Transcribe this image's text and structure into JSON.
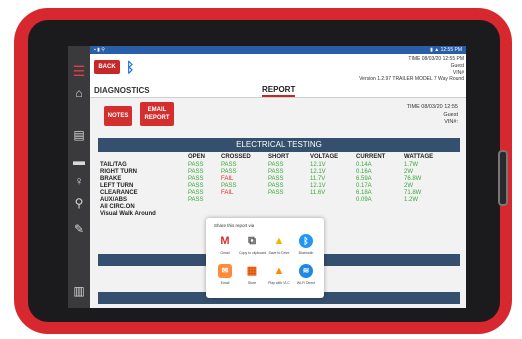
{
  "status_bar": {
    "left": "▪ ▮ ⚲",
    "right": "▮ ▲ 12:55 PM"
  },
  "header": {
    "back_label": "BACK",
    "time_line": "TIME 08/03/20 12:55 PM",
    "user_line": "Guest",
    "vin_line": "VIN#",
    "version_line": "Version 1.2.97   TRAILER MODEL 7 Way Round"
  },
  "tabs": {
    "diagnostics": "DIAGNOSTICS",
    "report": "REPORT"
  },
  "buttons": {
    "notes": "NOTES",
    "email_line1": "EMAIL",
    "email_line2": "REPORT"
  },
  "meta": {
    "time": "TIME 08/03/20 12:55",
    "user": "Guest",
    "vin": "VIN#:"
  },
  "electrical": {
    "title": "ELECTRICAL TESTING",
    "columns": [
      "OPEN",
      "CROSSED",
      "SHORT",
      "VOLTAGE",
      "CURRENT",
      "WATTAGE"
    ],
    "rows": [
      {
        "label": "TAIL/TAG",
        "open": "PASS",
        "crossed": "PASS",
        "short": "PASS",
        "voltage": "12.1V",
        "current": "0.14A",
        "wattage": "1.7W"
      },
      {
        "label": "RIGHT TURN",
        "open": "PASS",
        "crossed": "PASS",
        "short": "PASS",
        "voltage": "12.1V",
        "current": "0.16A",
        "wattage": "2W"
      },
      {
        "label": "BRAKE",
        "open": "PASS",
        "crossed": "FAIL",
        "short": "PASS",
        "voltage": "11.7V",
        "current": "6.59A",
        "wattage": "76.8W"
      },
      {
        "label": "LEFT TURN",
        "open": "PASS",
        "crossed": "PASS",
        "short": "PASS",
        "voltage": "12.1V",
        "current": "0.17A",
        "wattage": "2W"
      },
      {
        "label": "CLEARANCE",
        "open": "PASS",
        "crossed": "FAIL",
        "short": "PASS",
        "voltage": "11.6V",
        "current": "6.18A",
        "wattage": "71.8W"
      },
      {
        "label": "AUX/ABS",
        "open": "PASS",
        "crossed": "",
        "short": "",
        "voltage": "",
        "current": "0.09A",
        "wattage": "1.2W"
      },
      {
        "label": "All CIRC.ON",
        "open": "",
        "crossed": "",
        "short": "",
        "voltage": "",
        "current": "",
        "wattage": ""
      },
      {
        "label": "Visual Walk Around",
        "open": "",
        "crossed": "",
        "short": "",
        "voltage": "",
        "current": "",
        "wattage": ""
      }
    ]
  },
  "share": {
    "title": "Share this report via",
    "apps": [
      {
        "label": "Gmail",
        "icon": "gmail-icon",
        "glyph": "M"
      },
      {
        "label": "Copy to clipboard",
        "icon": "copy-icon",
        "glyph": "⧉"
      },
      {
        "label": "Save to Drive",
        "icon": "drive-icon",
        "glyph": "▲"
      },
      {
        "label": "Bluetooth",
        "icon": "bluetooth-icon",
        "glyph": "ᛒ"
      },
      {
        "label": "Email",
        "icon": "email-icon",
        "glyph": "✉"
      },
      {
        "label": "Store",
        "icon": "store-icon",
        "glyph": "▦"
      },
      {
        "label": "Play with VLC",
        "icon": "vlc-icon",
        "glyph": "▲"
      },
      {
        "label": "Wi-Fi Direct",
        "icon": "wifi-icon",
        "glyph": "≋"
      }
    ]
  },
  "colors": {
    "accent_red": "#d32f2f",
    "header_blue": "#34506e",
    "pass_green": "#38a838",
    "fail_red": "#e02828",
    "case_red": "#d8282f"
  }
}
